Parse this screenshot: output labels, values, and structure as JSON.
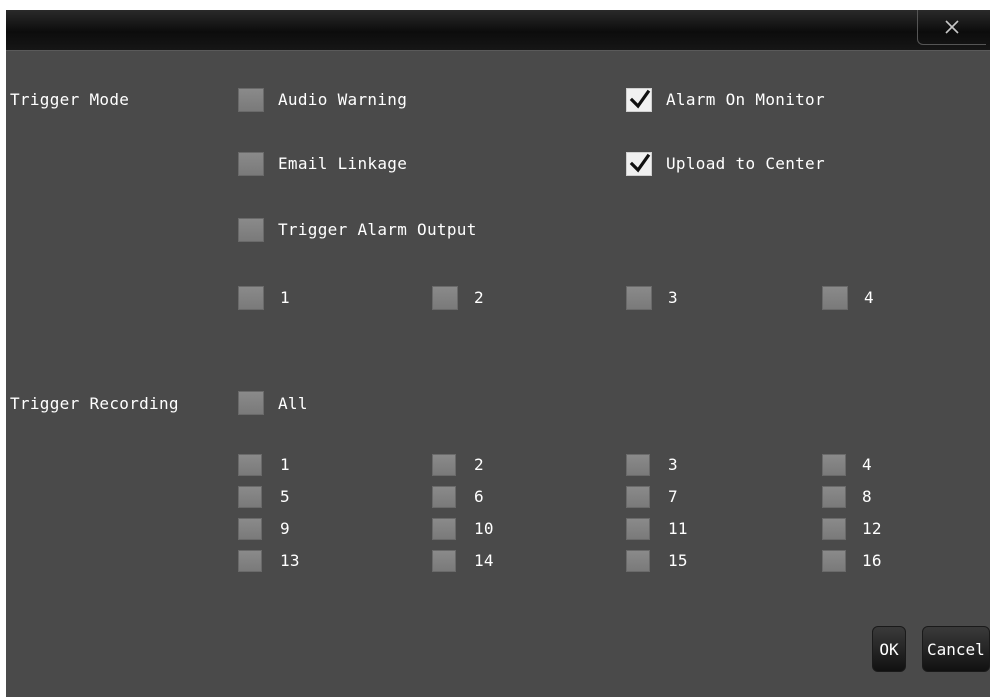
{
  "dialog": {
    "close_icon": "close-icon",
    "ok_label": "OK",
    "cancel_label": "Cancel"
  },
  "trigger_mode": {
    "label": "Trigger Mode",
    "audio_warning": {
      "label": "Audio Warning",
      "checked": false
    },
    "alarm_on_monitor": {
      "label": "Alarm On Monitor",
      "checked": true
    },
    "email_linkage": {
      "label": "Email Linkage",
      "checked": false
    },
    "upload_to_center": {
      "label": "Upload to Center",
      "checked": true
    },
    "trigger_alarm_output": {
      "label": "Trigger Alarm Output",
      "checked": false
    },
    "outputs": [
      {
        "label": "1",
        "checked": false
      },
      {
        "label": "2",
        "checked": false
      },
      {
        "label": "3",
        "checked": false
      },
      {
        "label": "4",
        "checked": false
      }
    ]
  },
  "trigger_recording": {
    "label": "Trigger Recording",
    "all": {
      "label": "All",
      "checked": false
    },
    "channels": [
      {
        "label": "1",
        "checked": false
      },
      {
        "label": "2",
        "checked": false
      },
      {
        "label": "3",
        "checked": false
      },
      {
        "label": "4",
        "checked": false
      },
      {
        "label": "5",
        "checked": false
      },
      {
        "label": "6",
        "checked": false
      },
      {
        "label": "7",
        "checked": false
      },
      {
        "label": "8",
        "checked": false
      },
      {
        "label": "9",
        "checked": false
      },
      {
        "label": "10",
        "checked": false
      },
      {
        "label": "11",
        "checked": false
      },
      {
        "label": "12",
        "checked": false
      },
      {
        "label": "13",
        "checked": false
      },
      {
        "label": "14",
        "checked": false
      },
      {
        "label": "15",
        "checked": false
      },
      {
        "label": "16",
        "checked": false
      }
    ]
  }
}
